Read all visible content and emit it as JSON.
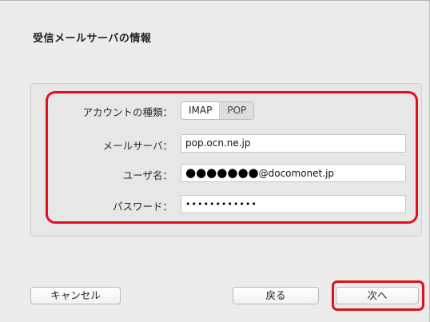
{
  "dialog": {
    "title": "受信メールサーバの情報"
  },
  "form": {
    "account_type_label": "アカウントの種類：",
    "account_types": [
      "IMAP",
      "POP"
    ],
    "selected_account_type": "IMAP",
    "mail_server_label": "メールサーバ：",
    "mail_server_value": "pop.ocn.ne.jp",
    "username_label": "ユーザ名：",
    "username_masked": "●●●●●●●",
    "username_domain": "@docomonet.jp",
    "password_label": "パスワード：",
    "password_value": "••••••••••••"
  },
  "buttons": {
    "cancel": "キャンセル",
    "back": "戻る",
    "next": "次へ"
  },
  "colors": {
    "highlight": "#e0101c",
    "dialog_background": "#ececec"
  }
}
